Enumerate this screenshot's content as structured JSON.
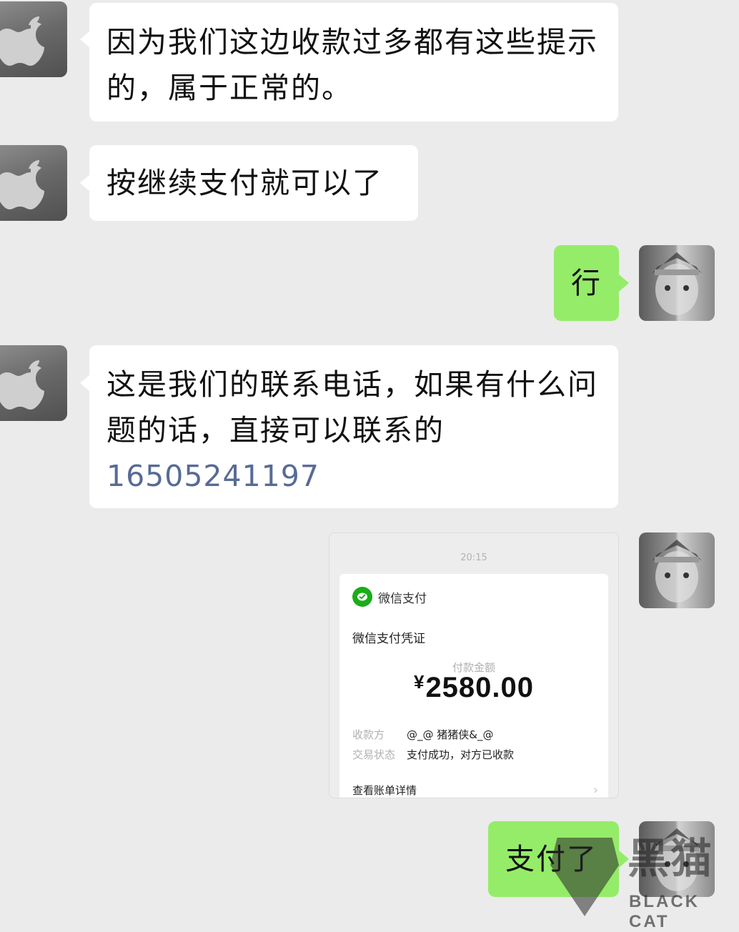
{
  "messages": [
    {
      "side": "left",
      "text": "因为我们这边收款过多都有这些提示的，属于正常的。"
    },
    {
      "side": "left",
      "text": "按继续支付就可以了"
    },
    {
      "side": "right",
      "text": "行"
    },
    {
      "side": "left",
      "text": "这是我们的联系电话，如果有什么问题的话，直接可以联系的",
      "phone": "16505241197"
    },
    {
      "side": "right",
      "text": "支付了"
    }
  ],
  "payment_card": {
    "time": "20:15",
    "brand": "微信支付",
    "title": "微信支付凭证",
    "amount_label": "付款金额",
    "currency_symbol": "¥",
    "amount": "2580.00",
    "payee_label": "收款方",
    "payee_value": "@_@ 猪猪侠&_@",
    "status_label": "交易状态",
    "status_value": "支付成功，对方已收款",
    "detail_link": "查看账单详情"
  },
  "watermark": {
    "cn": "黑猫",
    "en": "BLACK CAT"
  },
  "colors": {
    "background": "#ebebeb",
    "bubble_left": "#ffffff",
    "bubble_right": "#95ec69",
    "phone_link": "#576b95",
    "wechat_pay_green": "#1aad19"
  }
}
